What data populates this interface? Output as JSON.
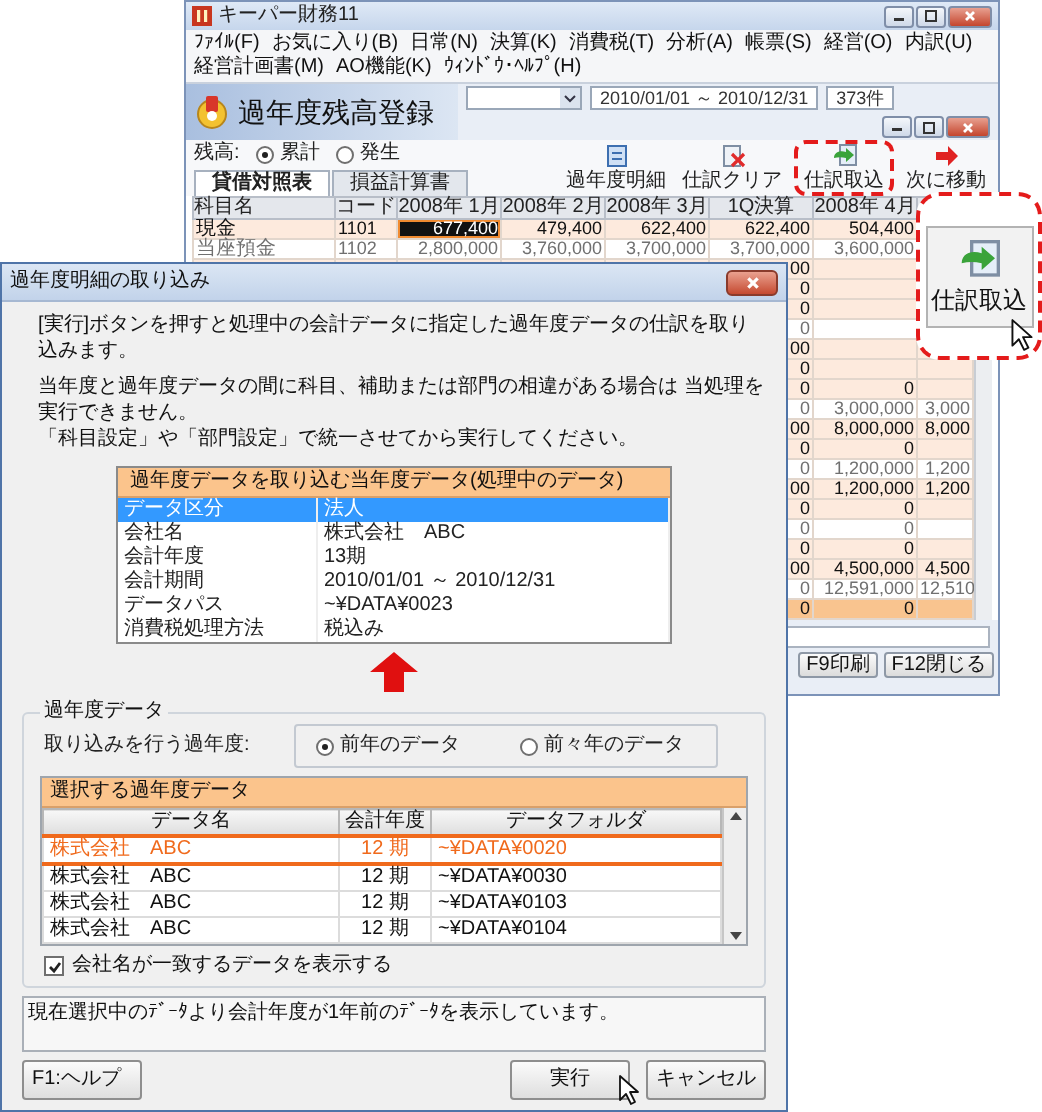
{
  "app_window": {
    "title": "キーパー財務11",
    "menu": [
      "ﾌｧｲﾙ(F)",
      "お気に入り(B)",
      "日常(N)",
      "決算(K)",
      "消費税(T)",
      "分析(A)",
      "帳票(S)",
      "経営(O)",
      "内訳(U)",
      "経営計画書(M)",
      "AO機能(K)",
      "ｳｨﾝﾄﾞｳ･ﾍﾙﾌﾟ(H)"
    ],
    "period": "2010/01/01 ～ 2010/12/31",
    "count": "373件"
  },
  "balance_window": {
    "title": "過年度残高登録",
    "balance_label": "残高:",
    "balance_options": [
      {
        "label": "累計",
        "selected": true
      },
      {
        "label": "発生",
        "selected": false
      }
    ],
    "tabs": [
      {
        "label": "貸借対照表",
        "selected": true
      },
      {
        "label": "損益計算書",
        "selected": false
      }
    ],
    "toolbar": [
      {
        "label": "過年度明細",
        "kind": "ledger",
        "circled": false
      },
      {
        "label": "仕訳クリア",
        "kind": "clear",
        "circled": false
      },
      {
        "label": "仕訳取込",
        "kind": "import",
        "circled": true
      },
      {
        "label": "次に移動",
        "kind": "next",
        "circled": false
      }
    ],
    "table": {
      "columns": [
        "科目名",
        "コード",
        "2008年 1月",
        "2008年 2月",
        "2008年 3月",
        "1Q決算",
        "2008年 4月"
      ],
      "rows": [
        {
          "kind": "full",
          "muted": false,
          "cells": [
            {
              "text": "現金",
              "selected": false
            },
            {
              "text": "1101",
              "selected": false
            },
            {
              "text": "677,400",
              "selected": true
            },
            {
              "text": "479,400",
              "selected": false
            },
            {
              "text": "622,400",
              "selected": false
            },
            {
              "text": "622,400",
              "selected": false
            },
            {
              "text": "504,400",
              "selected": false
            }
          ]
        },
        {
          "kind": "full",
          "muted": true,
          "cells": [
            {
              "text": "当座預金",
              "selected": false
            },
            {
              "text": "1102",
              "selected": false
            },
            {
              "text": "2,800,000",
              "selected": false
            },
            {
              "text": "3,760,000",
              "selected": false
            },
            {
              "text": "3,700,000",
              "selected": false
            },
            {
              "text": "3,700,000",
              "selected": false
            },
            {
              "text": "3,600,000",
              "selected": false
            }
          ]
        },
        {
          "kind": "partial",
          "muted": false,
          "cells": [
            {
              "text": "00",
              "selected": false
            }
          ]
        },
        {
          "kind": "partial",
          "muted": false,
          "cells": [
            {
              "text": "0",
              "selected": false
            }
          ]
        },
        {
          "kind": "partial",
          "muted": false,
          "cells": [
            {
              "text": "0",
              "selected": false
            }
          ]
        },
        {
          "kind": "partial",
          "muted": true,
          "cells": [
            {
              "text": "0",
              "selected": false
            }
          ]
        },
        {
          "kind": "partial",
          "muted": false,
          "cells": [
            {
              "text": "00",
              "selected": false
            }
          ]
        },
        {
          "kind": "partial",
          "muted": false,
          "cells": [
            {
              "text": "0",
              "selected": false
            }
          ]
        },
        {
          "kind": "partial",
          "muted": false,
          "cells": [
            {
              "text": "0",
              "selected": false
            },
            {
              "text": "0",
              "selected": false
            }
          ]
        },
        {
          "kind": "partial",
          "muted": true,
          "cells": [
            {
              "text": "0",
              "selected": false
            },
            {
              "text": "3,000,000",
              "selected": false
            },
            {
              "text": "3,000",
              "selected": false
            }
          ]
        },
        {
          "kind": "partial",
          "muted": false,
          "cells": [
            {
              "text": "00",
              "selected": false
            },
            {
              "text": "8,000,000",
              "selected": false
            },
            {
              "text": "8,000",
              "selected": false
            }
          ]
        },
        {
          "kind": "partial",
          "muted": false,
          "cells": [
            {
              "text": "0",
              "selected": false
            },
            {
              "text": "0",
              "selected": false
            }
          ]
        },
        {
          "kind": "partial",
          "muted": true,
          "cells": [
            {
              "text": "0",
              "selected": false
            },
            {
              "text": "1,200,000",
              "selected": false
            },
            {
              "text": "1,200",
              "selected": false
            }
          ]
        },
        {
          "kind": "partial",
          "muted": false,
          "cells": [
            {
              "text": "00",
              "selected": false
            },
            {
              "text": "1,200,000",
              "selected": false
            },
            {
              "text": "1,200",
              "selected": false
            }
          ]
        },
        {
          "kind": "partial",
          "muted": false,
          "cells": [
            {
              "text": "0",
              "selected": false
            },
            {
              "text": "0",
              "selected": false
            }
          ]
        },
        {
          "kind": "partial",
          "muted": true,
          "cells": [
            {
              "text": "0",
              "selected": false
            },
            {
              "text": "0",
              "selected": false
            }
          ]
        },
        {
          "kind": "partial",
          "muted": false,
          "cells": [
            {
              "text": "0",
              "selected": false
            },
            {
              "text": "0",
              "selected": false
            }
          ]
        },
        {
          "kind": "partial",
          "muted": false,
          "cells": [
            {
              "text": "00",
              "selected": false
            },
            {
              "text": "4,500,000",
              "selected": false
            },
            {
              "text": "4,500",
              "selected": false
            }
          ]
        },
        {
          "kind": "partial",
          "muted": true,
          "cells": [
            {
              "text": "0",
              "selected": false
            },
            {
              "text": "12,591,000",
              "selected": false
            },
            {
              "text": "12,510",
              "selected": false
            }
          ]
        },
        {
          "kind": "total",
          "muted": false,
          "cells": [
            {
              "text": "0",
              "selected": false
            },
            {
              "text": "0",
              "selected": false
            }
          ]
        }
      ]
    },
    "buttons": [
      "F9印刷",
      "F12閉じる"
    ]
  },
  "callout": {
    "label": "仕訳取込"
  },
  "dialog": {
    "title": "過年度明細の取り込み",
    "intro": [
      "[実行]ボタンを押すと処理中の会計データに指定した過年度データの仕訳を取り込みます。",
      "当年度と過年度データの間に科目、補助または部門の相違がある場合は 当処理を実行できません。",
      "「科目設定」や「部門設定」で統一させてから実行してください。"
    ],
    "current_data": {
      "title": "過年度データを取り込む当年度データ(処理中のデータ)",
      "rows": [
        {
          "label": "データ区分",
          "value": "法人",
          "selected": true
        },
        {
          "label": "会社名",
          "value": "株式会社　ABC",
          "selected": false
        },
        {
          "label": "会計年度",
          "value": "13期",
          "selected": false
        },
        {
          "label": "会計期間",
          "value": "2010/01/01 ～ 2010/12/31",
          "selected": false
        },
        {
          "label": "データパス",
          "value": "~¥DATA¥0023",
          "selected": false
        },
        {
          "label": "消費税処理方法",
          "value": "税込み",
          "selected": false
        }
      ]
    },
    "past_data": {
      "legend": "過年度データ",
      "year_label": "取り込みを行う過年度:",
      "year_options": [
        {
          "label": "前年のデータ",
          "selected": true
        },
        {
          "label": "前々年のデータ",
          "selected": false
        }
      ],
      "list": {
        "title": "選択する過年度データ",
        "columns": [
          "データ名",
          "会計年度",
          "データフォルダ"
        ],
        "rows": [
          {
            "cells": [
              "株式会社　ABC",
              "12 期",
              "~¥DATA¥0020"
            ],
            "selected": true
          },
          {
            "cells": [
              "株式会社　ABC",
              "12 期",
              "~¥DATA¥0030"
            ],
            "selected": false
          },
          {
            "cells": [
              "株式会社　ABC",
              "12 期",
              "~¥DATA¥0103"
            ],
            "selected": false
          },
          {
            "cells": [
              "株式会社　ABC",
              "12 期",
              "~¥DATA¥0104"
            ],
            "selected": false
          }
        ]
      },
      "match_company": {
        "label": "会社名が一致するデータを表示する",
        "checked": true
      }
    },
    "message": "現在選択中のﾃﾞｰﾀより会計年度が1年前のﾃﾞｰﾀを表示しています。",
    "buttons": [
      {
        "label": "F1:ヘルプ",
        "kind": "help",
        "pointer": false
      },
      {
        "label": "実行",
        "kind": "run",
        "pointer": true
      },
      {
        "label": "キャンセル",
        "kind": "cancel",
        "pointer": false
      }
    ]
  }
}
